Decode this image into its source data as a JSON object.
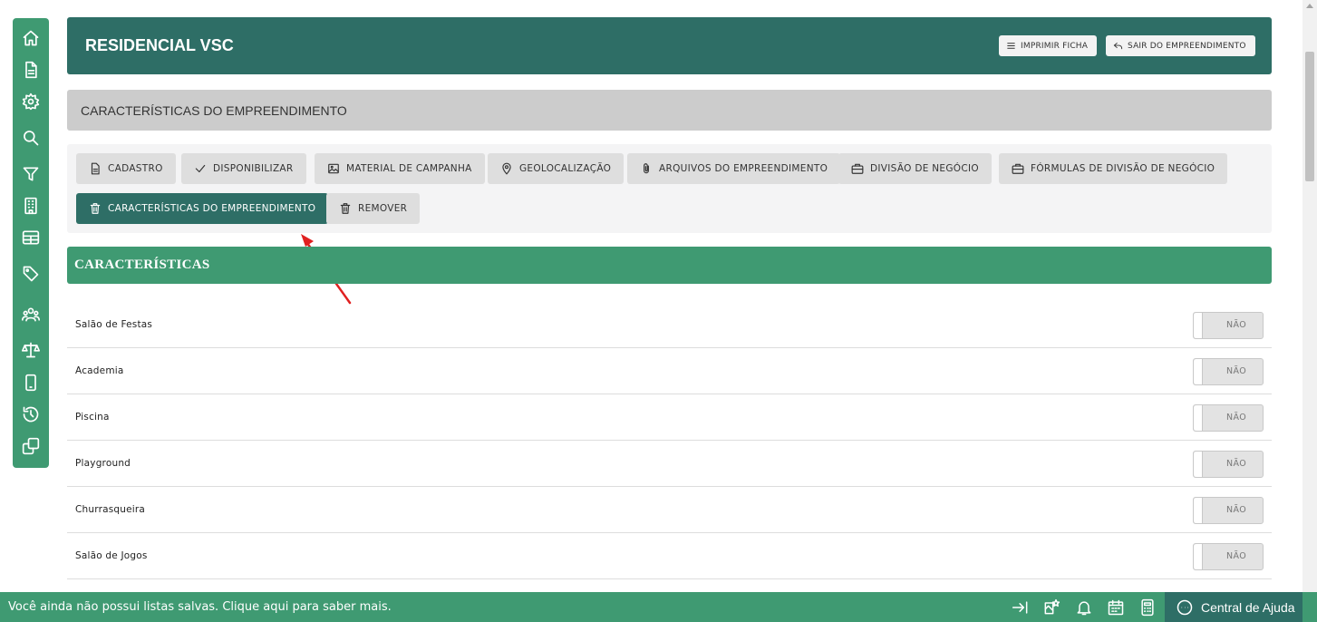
{
  "header": {
    "title": "RESIDENCIAL VSC",
    "print_label": "IMPRIMIR FICHA",
    "exit_label": "SAIR DO EMPREENDIMENTO"
  },
  "section_title": "CARACTERÍSTICAS DO EMPREENDIMENTO",
  "tabs": [
    {
      "label": "CADASTRO",
      "icon": "document-icon"
    },
    {
      "label": "DISPONIBILIZAR",
      "icon": "check-icon"
    },
    {
      "label": "MATERIAL DE CAMPANHA",
      "icon": "image-icon"
    },
    {
      "label": "GEOLOCALIZAÇÃO",
      "icon": "map-pin-icon"
    },
    {
      "label": "ARQUIVOS DO EMPREENDIMENTO",
      "icon": "paperclip-icon"
    },
    {
      "label": "DIVISÃO DE NEGÓCIO",
      "icon": "briefcase-icon"
    },
    {
      "label": "FÓRMULAS DE DIVISÃO DE NEGÓCIO",
      "icon": "briefcase-icon"
    },
    {
      "label": "CARACTERÍSTICAS DO EMPREENDIMENTO",
      "icon": "trash-icon",
      "active": true
    },
    {
      "label": "REMOVER",
      "icon": "trash-icon"
    }
  ],
  "characteristics": {
    "title": "CARACTERÍSTICAS",
    "items": [
      {
        "label": "Salão de Festas",
        "value": "NÃO"
      },
      {
        "label": "Academia",
        "value": "NÃO"
      },
      {
        "label": "Piscina",
        "value": "NÃO"
      },
      {
        "label": "Playground",
        "value": "NÃO"
      },
      {
        "label": "Churrasqueira",
        "value": "NÃO"
      },
      {
        "label": "Salão de Jogos",
        "value": "NÃO"
      }
    ]
  },
  "bottom_bar": {
    "message": "Você ainda não possui listas salvas. Clique aqui para saber mais.",
    "help_label": "Central de Ajuda"
  },
  "colors": {
    "dark_teal": "#2e6e66",
    "green": "#3f9a72",
    "annotation_arrow": "#e02020"
  }
}
